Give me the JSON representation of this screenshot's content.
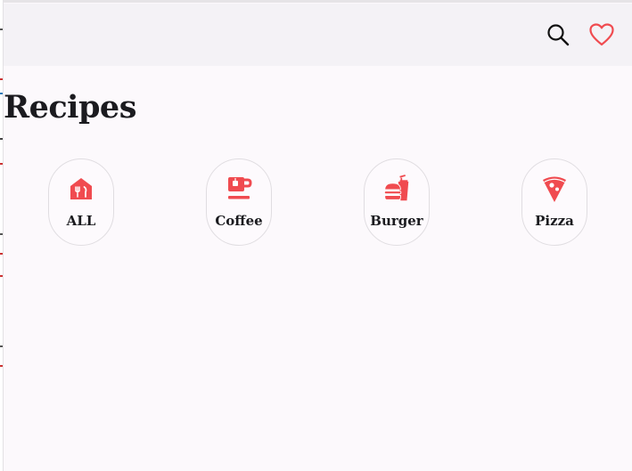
{
  "header": {
    "search_icon": "search-icon",
    "favorites_icon": "heart-outline-icon"
  },
  "page": {
    "title": "Recipes"
  },
  "categories": [
    {
      "label": "ALL",
      "icon": "home-utensils-icon"
    },
    {
      "label": "Coffee",
      "icon": "coffee-cup-icon"
    },
    {
      "label": "Burger",
      "icon": "burger-drink-icon"
    },
    {
      "label": "Pizza",
      "icon": "pizza-slice-icon"
    }
  ],
  "colors": {
    "accent": "#f04b50",
    "header_bg": "#f4f2f6",
    "page_bg": "#fcf9fc",
    "text": "#1b1b1f",
    "chip_border": "#e0dde1"
  }
}
